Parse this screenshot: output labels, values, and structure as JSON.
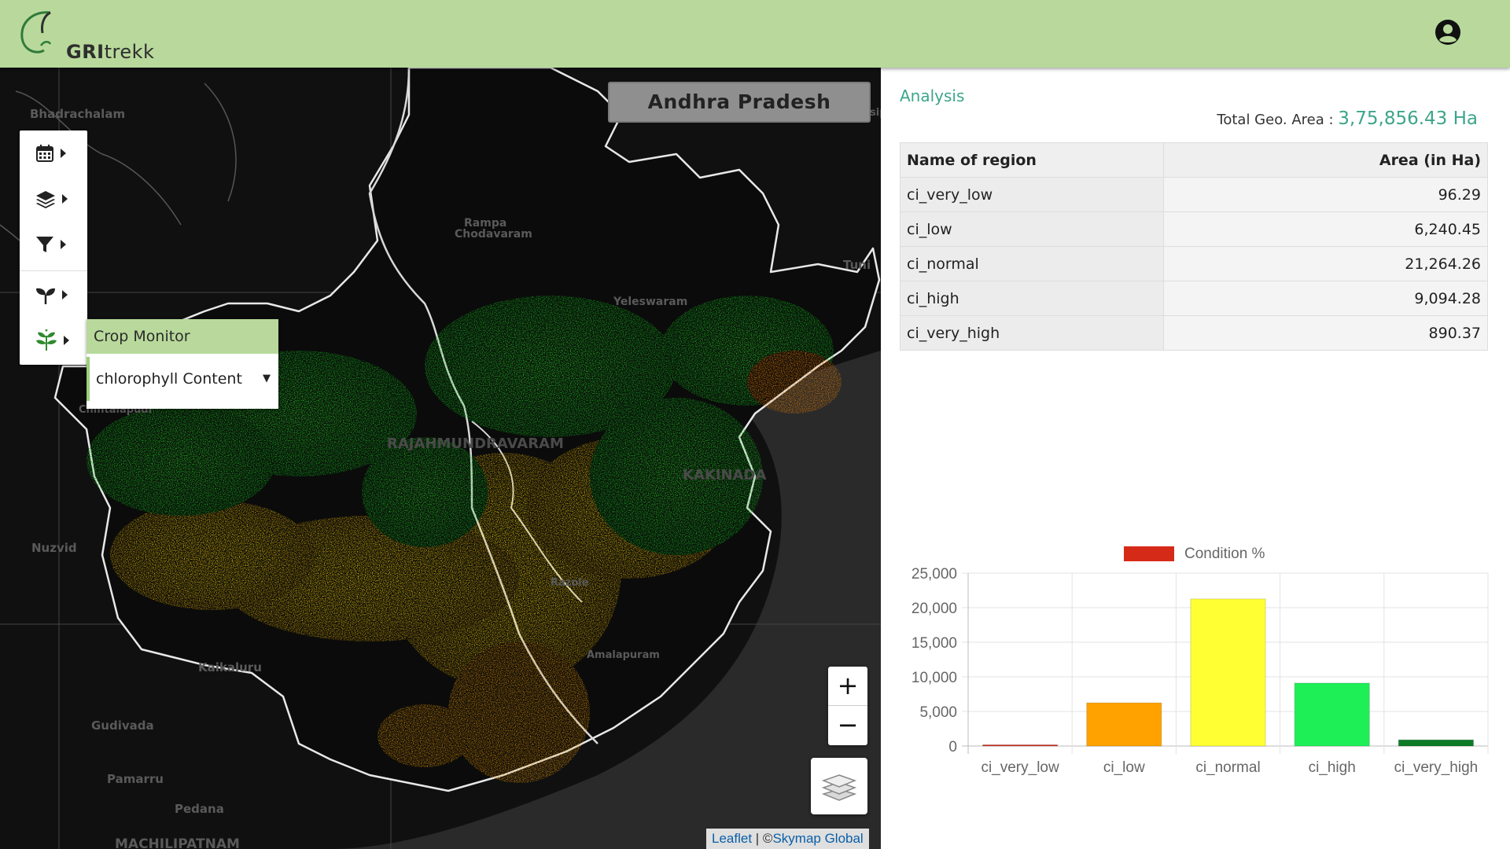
{
  "app": {
    "logo_prefix": "GRI",
    "logo_suffix": "trekk"
  },
  "map": {
    "region_title": "Andhra Pradesh",
    "places": [
      "Bhadrachalam",
      "Rampa",
      "Chodavaram",
      "Yeleswaram",
      "RAJAHMUNDRAVARAM",
      "KAKINADA",
      "Nuzvid",
      "Kaikaluru",
      "Gudivada",
      "Pamarru",
      "Pedana",
      "MACHILIPATNAM",
      "Tuni",
      "Narsipatnam",
      "Chintalapudi",
      "Amalapuram",
      "Razole"
    ],
    "toolbar_icons": [
      "calendar-icon",
      "layers-icon",
      "filter-icon",
      "sprout-icon",
      "crop-leaf-icon"
    ],
    "crop_panel": {
      "title": "Crop Monitor",
      "selected_option": "chlorophyll Content",
      "arrow": "▼"
    },
    "zoom_in": "+",
    "zoom_out": "−",
    "attribution": {
      "leaflet": "Leaflet",
      "separator": " | ©",
      "provider": "Skymap Global"
    }
  },
  "panel": {
    "title": "Analysis",
    "total_area_label": "Total Geo. Area :",
    "total_area_value": "3,75,856.43 Ha",
    "table": {
      "headers": [
        "Name of region",
        "Area (in Ha)"
      ],
      "rows": [
        [
          "ci_very_low",
          "96.29"
        ],
        [
          "ci_low",
          "6,240.45"
        ],
        [
          "ci_normal",
          "21,264.26"
        ],
        [
          "ci_high",
          "9,094.28"
        ],
        [
          "ci_very_high",
          "890.37"
        ]
      ]
    }
  },
  "chart_data": {
    "type": "bar",
    "categories": [
      "ci_very_low",
      "ci_low",
      "ci_normal",
      "ci_high",
      "ci_very_high"
    ],
    "series": [
      {
        "name": "Condition %",
        "values": [
          96.29,
          6240.45,
          21264.26,
          9094.28,
          890.37
        ]
      }
    ],
    "bar_colors": [
      "#d62a18",
      "#ffa200",
      "#ffff33",
      "#1fef57",
      "#0d7a28"
    ],
    "legend_color": "#d62a18",
    "yticks": [
      "0",
      "5,000",
      "10,000",
      "15,000",
      "20,000",
      "25,000"
    ],
    "ylim": [
      0,
      25000
    ],
    "grid": true,
    "legend_position": "top"
  }
}
